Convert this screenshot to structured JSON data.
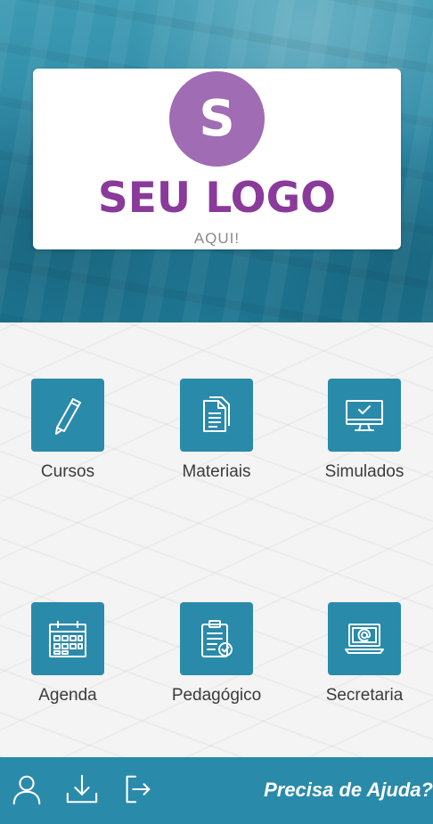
{
  "logo": {
    "letter": "S",
    "title": "SEU LOGO",
    "subtitle": "AQUI!"
  },
  "menu": [
    {
      "label": "Cursos",
      "icon": "pencil-icon"
    },
    {
      "label": "Materiais",
      "icon": "documents-icon"
    },
    {
      "label": "Simulados",
      "icon": "monitor-check-icon"
    },
    {
      "label": "Agenda",
      "icon": "calendar-icon"
    },
    {
      "label": "Pedagógico",
      "icon": "clipboard-check-icon"
    },
    {
      "label": "Secretaria",
      "icon": "laptop-email-icon"
    }
  ],
  "footer": {
    "help_label": "Precisa de Ajuda?",
    "icons": [
      "user-icon",
      "download-icon",
      "logout-icon"
    ]
  },
  "colors": {
    "primary": "#2a8aaa",
    "logo_purple": "#8a3a9a",
    "logo_circle": "#a06cb3"
  }
}
